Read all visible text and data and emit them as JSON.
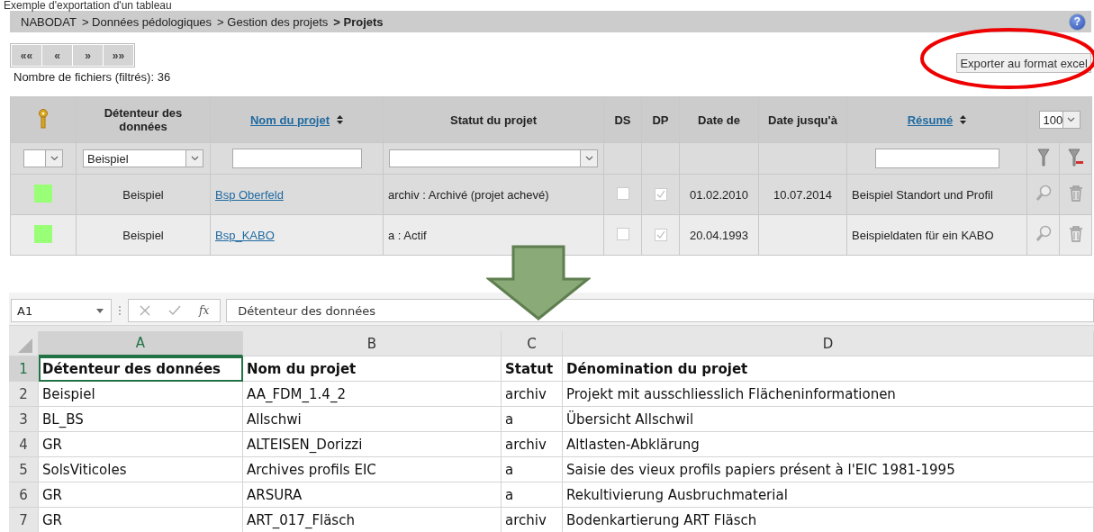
{
  "caption": "Exemple d'exportation d'un tableau",
  "breadcrumb": [
    {
      "label": "NABODAT",
      "current": false
    },
    {
      "label": "> Données pédologiques",
      "current": false
    },
    {
      "label": "> Gestion des projets",
      "current": false
    },
    {
      "label": "> Projets",
      "current": true
    }
  ],
  "help_button": "?",
  "pager": [
    "««",
    "«",
    "»",
    "»»"
  ],
  "file_count": "Nombre de fichiers (filtrés): 36",
  "export_button": "Exporter au format excel",
  "table": {
    "columns": [
      {
        "label": "Détenteur des données",
        "sortable": false
      },
      {
        "label": "Nom du projet",
        "sortable": true
      },
      {
        "label": "Statut du projet",
        "sortable": false
      },
      {
        "label": "DS",
        "sortable": false
      },
      {
        "label": "DP",
        "sortable": false
      },
      {
        "label": "Date de",
        "sortable": false
      },
      {
        "label": "Date jusqu'à",
        "sortable": false
      },
      {
        "label": "Résumé",
        "sortable": true
      }
    ],
    "page_size": "100",
    "holder_filter": "Beispiel",
    "rows": [
      {
        "color": "#99ff77",
        "holder": "Beispiel",
        "name": "Bsp Oberfeld",
        "status": "archiv : Archivé (projet achevé)",
        "ds": false,
        "dp": true,
        "date_from": "01.02.2010",
        "date_to": "10.07.2014",
        "summary": "Beispiel Standort und Profil"
      },
      {
        "color": "#99ff77",
        "holder": "Beispiel",
        "name": "Bsp_KABO",
        "status": "a : Actif",
        "ds": false,
        "dp": true,
        "date_from": "20.04.1993",
        "date_to": "",
        "summary": "Beispieldaten für ein KABO"
      }
    ]
  },
  "spreadsheet": {
    "name_box": "A1",
    "function_button": "fx",
    "formula": "Détenteur des données",
    "columns": [
      {
        "letter": "A",
        "selected": true
      },
      {
        "letter": "B",
        "selected": false
      },
      {
        "letter": "C",
        "selected": false
      },
      {
        "letter": "D",
        "selected": false
      }
    ],
    "rows": [
      {
        "number": "1",
        "kind": "header",
        "selected": true,
        "cells": [
          "Détenteur des données",
          "Nom du projet",
          "Statut",
          "Dénomination du projet"
        ]
      },
      {
        "number": "2",
        "kind": "data",
        "selected": false,
        "cells": [
          "Beispiel",
          "AA_FDM_1.4_2",
          "archiv",
          "Projekt mit ausschliesslich Flächeninformationen"
        ]
      },
      {
        "number": "3",
        "kind": "data",
        "selected": false,
        "cells": [
          "BL_BS",
          "Allschwi",
          "a",
          "Übersicht Allschwil"
        ]
      },
      {
        "number": "4",
        "kind": "data",
        "selected": false,
        "cells": [
          "GR",
          "ALTEISEN_Dorizzi",
          "archiv",
          "Altlasten-Abklärung"
        ]
      },
      {
        "number": "5",
        "kind": "data",
        "selected": false,
        "cells": [
          "SolsViticoles",
          "Archives profils EIC",
          "a",
          "Saisie des vieux profils papiers présent à l'EIC 1981-1995"
        ]
      },
      {
        "number": "6",
        "kind": "data",
        "selected": false,
        "cells": [
          "GR",
          "ARSURA",
          "a",
          "Rekultivierung Ausbruchmaterial"
        ]
      },
      {
        "number": "7",
        "kind": "data",
        "selected": false,
        "cells": [
          "GR",
          "ART_017_Fläsch",
          "archiv",
          "Bodenkartierung ART Fläsch"
        ]
      }
    ]
  }
}
